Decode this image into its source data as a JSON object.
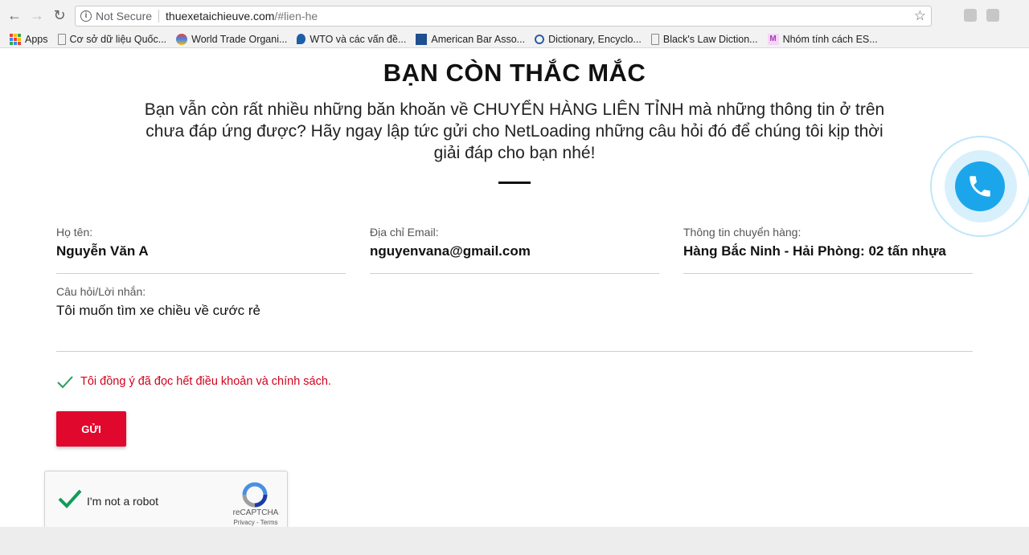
{
  "browser": {
    "security_label": "Not Secure",
    "url_host": "thuexetaichieuve.com",
    "url_path": "/#lien-he",
    "bookmarks": [
      {
        "label": "Apps"
      },
      {
        "label": "Cơ sở dữ liệu Quốc..."
      },
      {
        "label": "World Trade Organi..."
      },
      {
        "label": "WTO và các vấn đề..."
      },
      {
        "label": "American Bar Asso..."
      },
      {
        "label": "Dictionary, Encyclo..."
      },
      {
        "label": "Black's Law Diction..."
      },
      {
        "label": "Nhóm tính cách ES..."
      }
    ]
  },
  "section": {
    "title": "BẠN CÒN THẮC MẮC",
    "description": "Bạn vẫn còn rất nhiều những băn khoăn về CHUYỂN HÀNG LIÊN TỈNH mà những thông tin ở trên chưa đáp ứng được? Hãy ngay lập tức gửi cho NetLoading những câu hỏi đó để chúng tôi kịp thời giải đáp cho bạn nhé!"
  },
  "form": {
    "name": {
      "label": "Họ tên:",
      "value": "Nguyễn Văn A"
    },
    "email": {
      "label": "Địa chỉ Email:",
      "value": "nguyenvana@gmail.com"
    },
    "shipping": {
      "label": "Thông tin chuyển hàng:",
      "value": "Hàng Bắc Ninh - Hải Phòng: 02 tấn nhựa"
    },
    "message": {
      "label": "Câu hỏi/Lời nhắn:",
      "value": "Tôi muốn tìm xe chiều về cước rẻ"
    },
    "agree_text": "Tôi đồng ý đã đọc hết điều khoản và chính sách.",
    "submit_label": "GỬI"
  },
  "captcha": {
    "label": "I'm not a robot",
    "brand": "reCAPTCHA",
    "terms": "Privacy - Terms"
  },
  "colors": {
    "accent": "#e0082d",
    "phone": "#1ba6ec"
  }
}
